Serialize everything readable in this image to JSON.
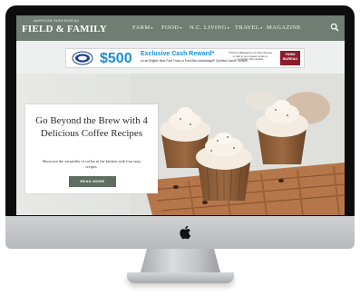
{
  "site": {
    "logo_small": "AMERICAN FARM BUREAU",
    "logo_main": "FIELD & FAMILY"
  },
  "nav": {
    "items": [
      {
        "label": "FARM"
      },
      {
        "label": "FOOD"
      },
      {
        "label": "N.C. LIVING"
      },
      {
        "label": "TRAVEL"
      },
      {
        "label": "MAGAZINE"
      }
    ],
    "search_icon": "search-icon"
  },
  "ad": {
    "price": "$500",
    "headline": "Exclusive Cash Reward*",
    "subline": "on an Eligible New Ford Truck or Ford Blue Advantage® Certified Used® Vehicle.",
    "fine_print": "*Visit FordRewards.com/farmbureau or talk to your dealer today to complete offer details",
    "brand": "FARM BUREAU"
  },
  "hero": {
    "title": "Go Beyond the Brew with 4 Delicious Coffee Recipes",
    "description": "Showcase the versatility of coffee in the kitchen with four tasty recipes.",
    "button": "READ MORE"
  },
  "colors": {
    "nav_bg": "#6f7d72",
    "ad_accent": "#1a8fd6",
    "button_bg": "#5d6d5f"
  }
}
